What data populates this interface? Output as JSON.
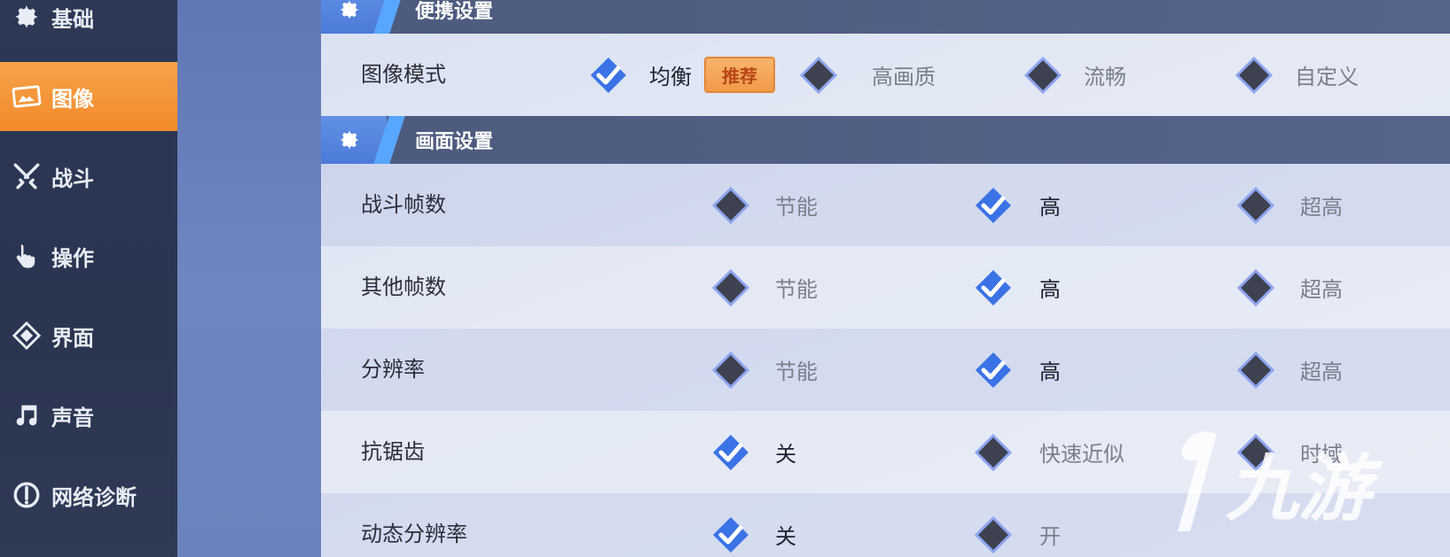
{
  "sidebar": {
    "items": [
      {
        "label": "基础",
        "icon": "gear-icon"
      },
      {
        "label": "图像",
        "icon": "image-icon",
        "active": true
      },
      {
        "label": "战斗",
        "icon": "crossed-swords-icon"
      },
      {
        "label": "操作",
        "icon": "tap-hand-icon"
      },
      {
        "label": "界面",
        "icon": "interface-icon"
      },
      {
        "label": "声音",
        "icon": "music-note-icon"
      },
      {
        "label": "网络诊断",
        "icon": "network-icon"
      }
    ]
  },
  "sections": {
    "quick": {
      "title": "便携设置",
      "row": {
        "label": "图像模式",
        "options": [
          "均衡",
          "高画质",
          "流畅",
          "自定义"
        ],
        "selected": 0,
        "badge": "推荐"
      }
    },
    "screen": {
      "title": "画面设置",
      "rows": [
        {
          "label": "战斗帧数",
          "options": [
            "节能",
            "高",
            "超高"
          ],
          "selected": 1
        },
        {
          "label": "其他帧数",
          "options": [
            "节能",
            "高",
            "超高"
          ],
          "selected": 1
        },
        {
          "label": "分辨率",
          "options": [
            "节能",
            "高",
            "超高"
          ],
          "selected": 1
        },
        {
          "label": "抗锯齿",
          "options": [
            "关",
            "快速近似",
            "时域"
          ],
          "selected": 0
        },
        {
          "label": "动态分辨率",
          "options": [
            "关",
            "开"
          ],
          "selected": 0
        }
      ]
    }
  },
  "watermark": {
    "text": "九游"
  },
  "colors": {
    "accent_orange": "#f28a2a",
    "header_blue": "#4c7ad8",
    "check_blue": "#3b73e6",
    "diamond_dark": "#3d4150"
  }
}
